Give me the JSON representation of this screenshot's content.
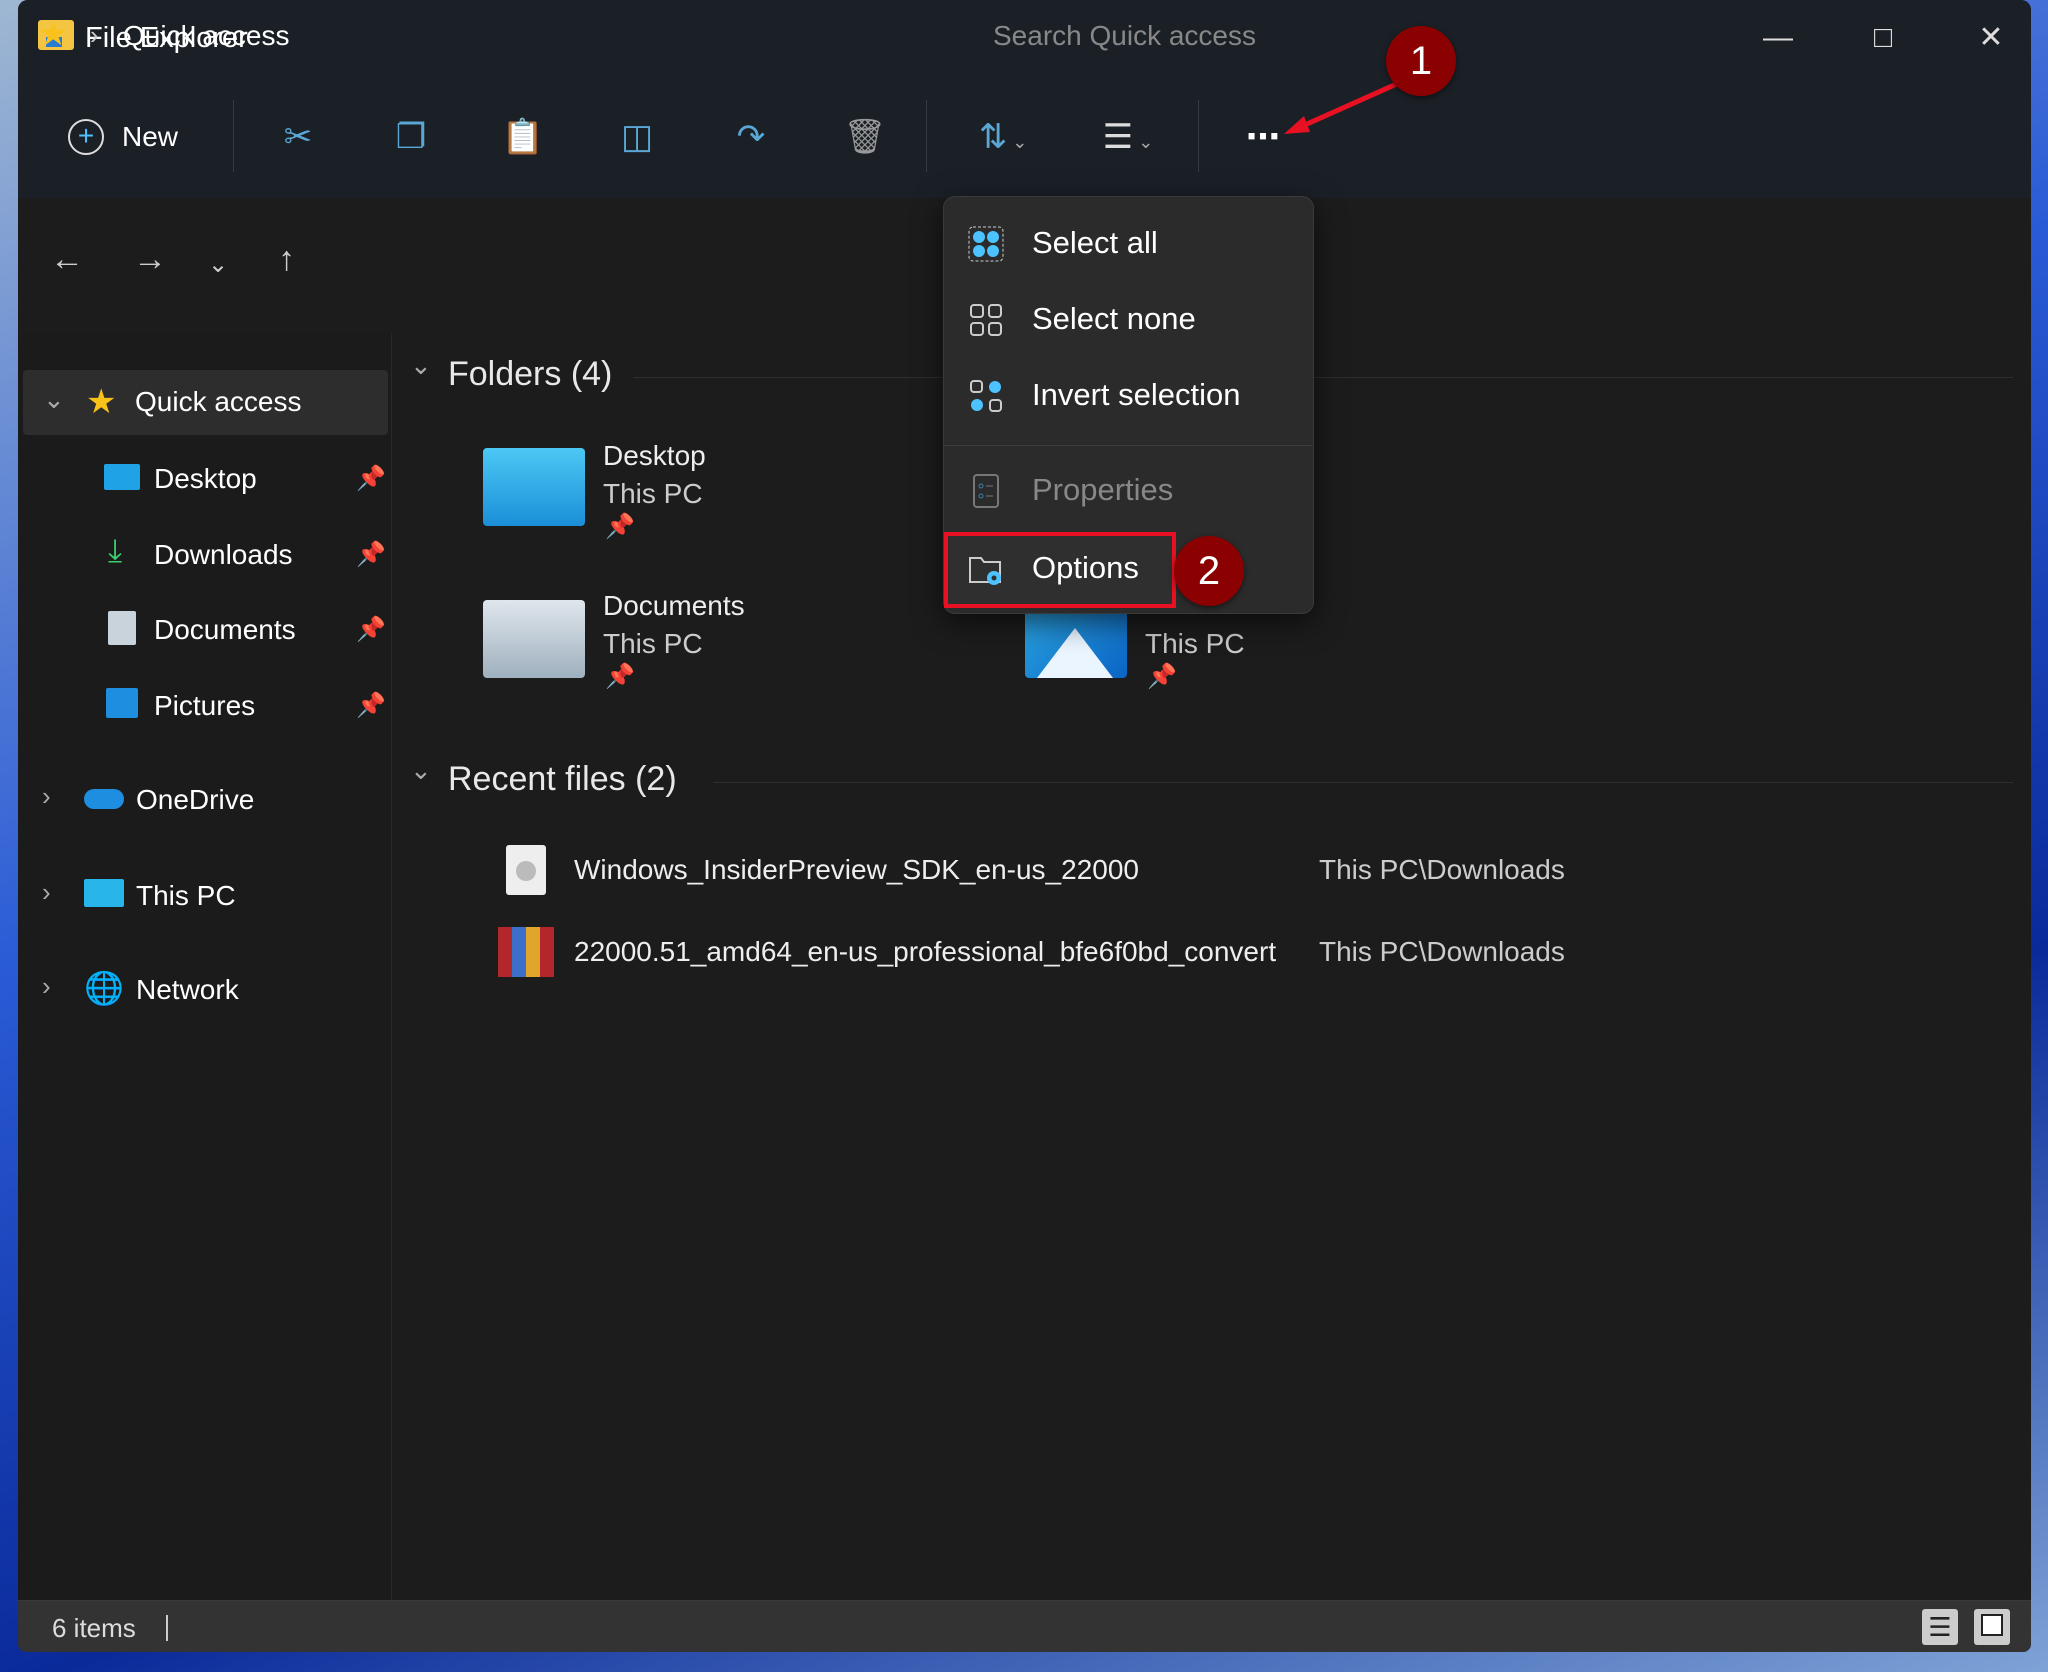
{
  "window": {
    "title": "File Explorer",
    "controls": [
      "minimize",
      "maximize",
      "close"
    ]
  },
  "toolbar": {
    "new_label": "New",
    "buttons": [
      "cut-icon",
      "copy-icon",
      "paste-icon",
      "rename-icon",
      "share-icon",
      "delete-icon",
      "sort-icon",
      "view-icon",
      "more-icon"
    ]
  },
  "address": {
    "location": "Quick access",
    "search_placeholder": "Search Quick access"
  },
  "sidebar": {
    "items": [
      {
        "label": "Quick access",
        "expanded": true,
        "selected": true
      },
      {
        "label": "Desktop",
        "pinned": true
      },
      {
        "label": "Downloads",
        "pinned": true
      },
      {
        "label": "Documents",
        "pinned": true
      },
      {
        "label": "Pictures",
        "pinned": true
      },
      {
        "label": "OneDrive"
      },
      {
        "label": "This PC"
      },
      {
        "label": "Network"
      }
    ]
  },
  "main": {
    "folders_header": "Folders (4)",
    "folders": [
      {
        "name": "Desktop",
        "location": "This PC"
      },
      {
        "name": "Documents",
        "location": "This PC"
      },
      {
        "name": "",
        "location": "This PC"
      }
    ],
    "recent_header": "Recent files (2)",
    "recent": [
      {
        "name": "Windows_InsiderPreview_SDK_en-us_22000",
        "path": "This PC\\Downloads"
      },
      {
        "name": "22000.51_amd64_en-us_professional_bfe6f0bd_convert",
        "path": "This PC\\Downloads"
      }
    ]
  },
  "menu": {
    "items": [
      {
        "label": "Select all",
        "icon": "select-all-icon"
      },
      {
        "label": "Select none",
        "icon": "select-none-icon"
      },
      {
        "label": "Invert selection",
        "icon": "invert-selection-icon"
      },
      {
        "label": "Properties",
        "icon": "properties-icon",
        "disabled": true
      },
      {
        "label": "Options",
        "icon": "options-icon",
        "highlighted": true
      }
    ]
  },
  "annotations": {
    "step1": "1",
    "step2": "2",
    "color": "#8b0000",
    "highlight": "#e81123"
  },
  "status": {
    "items": "6 items"
  },
  "colors": {
    "accent": "#4cc2ff",
    "window_bg": "#1c1c1c",
    "toolbar_bg": "#1b2027"
  }
}
